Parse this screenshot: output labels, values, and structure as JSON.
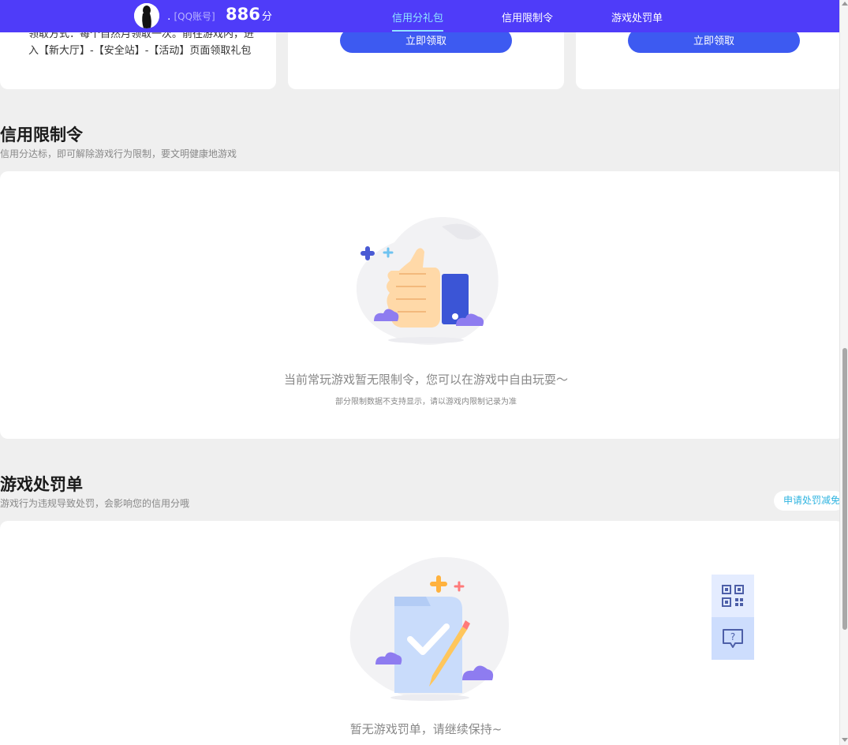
{
  "topbar": {
    "account_dot": ".",
    "account_label": "[QQ账号]",
    "score_value": "886",
    "score_unit": "分",
    "tabs": [
      {
        "label": "信用分礼包",
        "active": true
      },
      {
        "label": "信用限制令",
        "active": false
      },
      {
        "label": "游戏处罚单",
        "active": false
      }
    ]
  },
  "gift": {
    "desc": "领取方式：每个自然月领取一次。前往游戏内，进入【新大厅】-【安全站】-【活动】页面领取礼包",
    "claim_label_2": "立即领取",
    "claim_label_3": "立即领取"
  },
  "restriction": {
    "title": "信用限制令",
    "subtitle": "信用分达标，即可解除游戏行为限制，要文明健康地游戏",
    "empty_main": "当前常玩游戏暂无限制令，您可以在游戏中自由玩耍～",
    "empty_note": "部分限制数据不支持显示，请以游戏内限制记录为准"
  },
  "penalty": {
    "title": "游戏处罚单",
    "subtitle": "游戏行为违规导致处罚，会影响您的信用分哦",
    "appeal_label": "申请处罚减免",
    "empty_main": "暂无游戏罚单，请继续保持~"
  },
  "colors": {
    "topbar": "#4f3cf9",
    "button": "#3d5af1",
    "active_tab": "#8ee6ff",
    "appeal": "#2fb4e0"
  },
  "icons": {
    "avatar": "avatar-silhouette",
    "float_1": "qr-code-icon",
    "float_2": "help-chat-icon"
  }
}
